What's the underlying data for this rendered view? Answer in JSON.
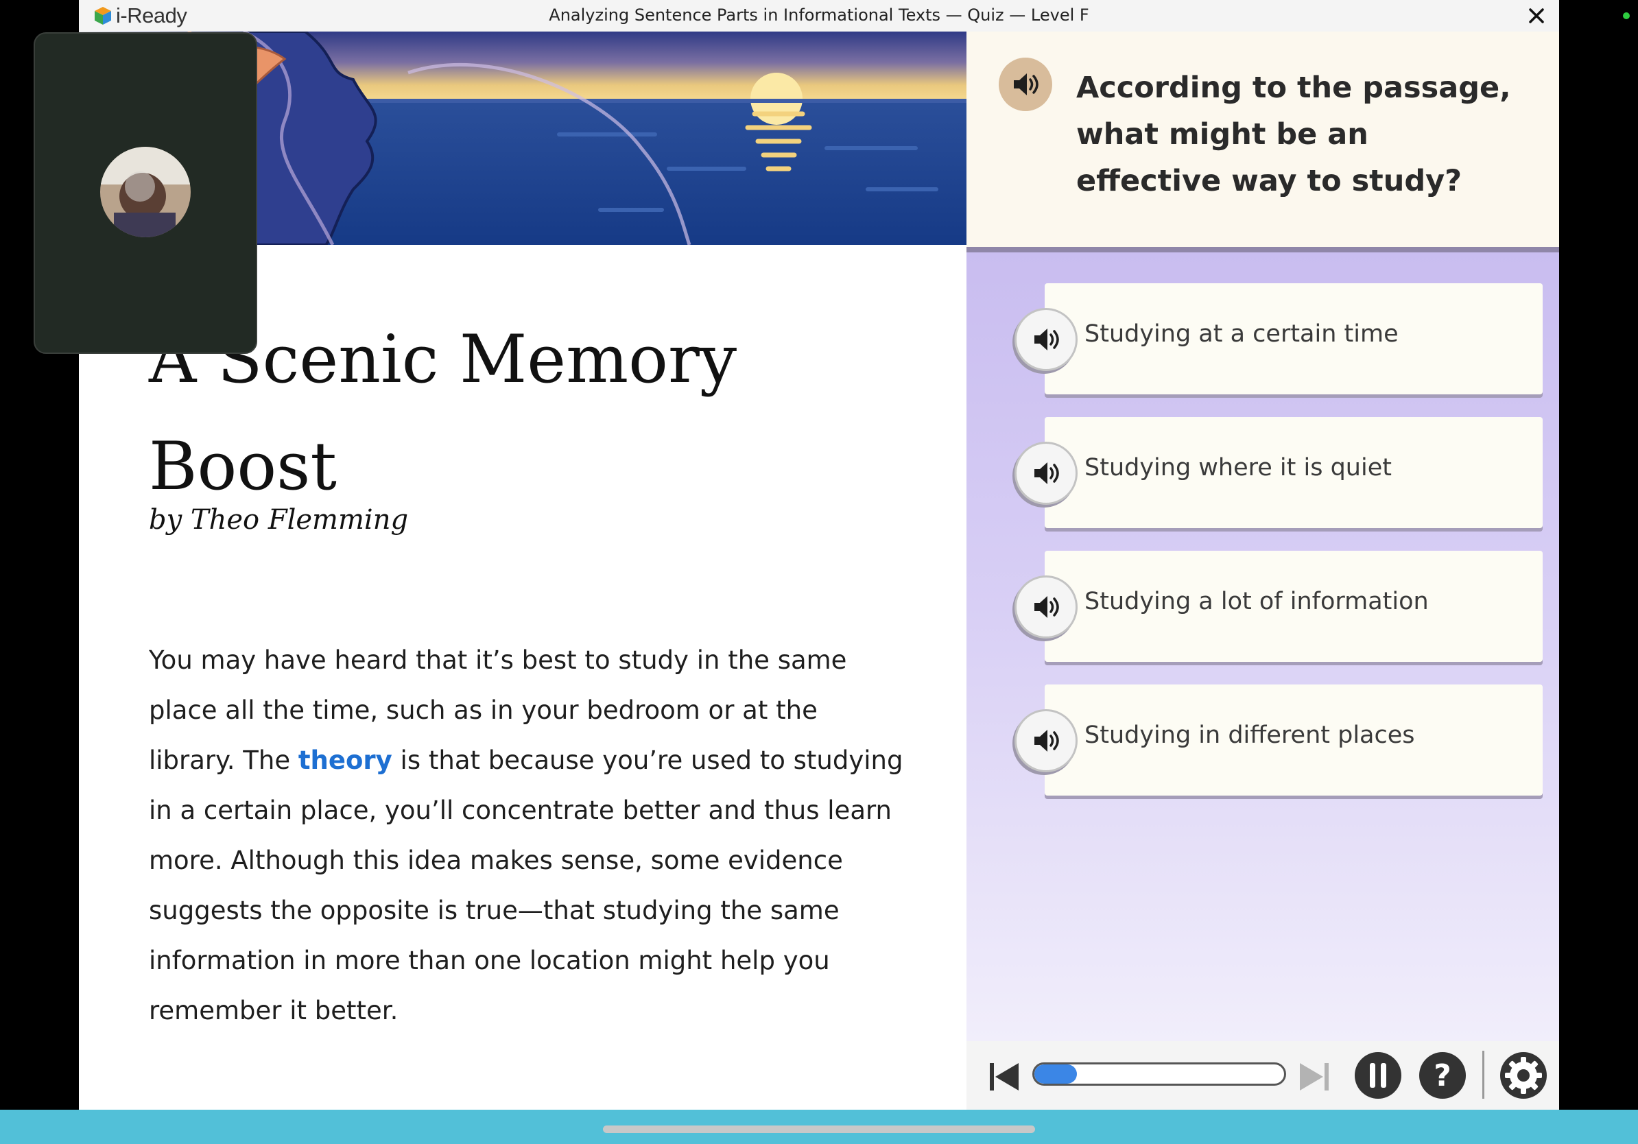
{
  "app": {
    "logo_text": "i-Ready",
    "window_title": "Analyzing Sentence Parts in Informational Texts — Quiz — Level F"
  },
  "passage": {
    "title": "A Scenic Memory Boost",
    "byline": "by Theo Flemming",
    "body_before": "You may have heard that it’s best to study in the same place all the time, such as in your bedroom or at the library. The ",
    "vocab_word": "theory",
    "body_after": " is that because you’re used to studying in a certain place, you’ll concentrate better and thus learn more. Although this idea makes sense, some evidence suggests the opposite is true—that studying the same information in more than one location might help you remember it better."
  },
  "question": {
    "text": "According to the passage, what might be an effective way to study?"
  },
  "answers": [
    {
      "label": "Studying at a certain time"
    },
    {
      "label": "Studying where it is quiet"
    },
    {
      "label": "Studying a lot of information"
    },
    {
      "label": "Studying in different places"
    }
  ],
  "audio_player": {
    "progress_fraction": 0.17
  },
  "colors": {
    "accent_blue": "#3b86e6",
    "vocab_link": "#1d6fd2",
    "answers_bg": "#c9bdf0",
    "question_bg": "#fcf8ee",
    "bottom_strip": "#52c0d8"
  },
  "icons": [
    "iready-logo-icon",
    "close-icon",
    "speaker-icon",
    "skip-back-icon",
    "skip-forward-icon",
    "pause-icon",
    "help-icon",
    "settings-icon"
  ]
}
